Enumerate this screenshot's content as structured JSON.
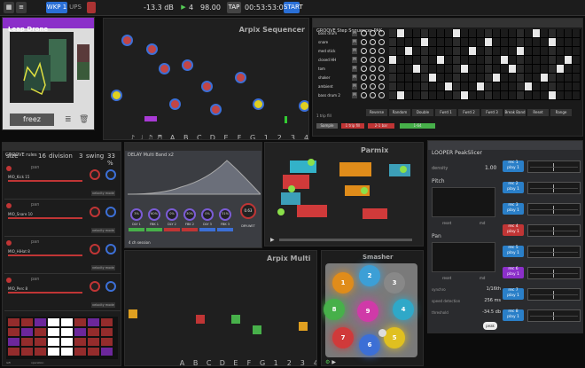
{
  "topbar": {
    "zoom_label": "WKP 1",
    "ups_label": "UPS",
    "db_value": "-13.3 dB",
    "bpm": "98.00",
    "tap": "TAP",
    "time": "00:53:53:08",
    "start": "START",
    "meter": "4"
  },
  "leap": {
    "title": "Leap Drone",
    "freeze": "freez"
  },
  "arpix_seq": {
    "title": "Arpix Sequencer",
    "letters": [
      "A",
      "B",
      "C",
      "D",
      "E",
      "F",
      "G"
    ],
    "numbers": [
      "1",
      "2",
      "3",
      "4",
      "5",
      "6",
      "7",
      "8",
      "S"
    ]
  },
  "groove": {
    "title": "GROOVE Step Sequencer PAK",
    "rows": [
      "bass drum",
      "snare",
      "med stick",
      "closed HH",
      "tom",
      "shaker",
      "ambient",
      "bass drum 2"
    ],
    "buttons": [
      "Reverse",
      "Random",
      "Double",
      "Fwrd 1",
      "Fwrd 2",
      "Fwrd 3",
      "Break Band",
      "Reset",
      "Range"
    ],
    "strip_label": "1 trip fill",
    "strip_vals": [
      "Sample",
      "1 trip fill",
      "2-1 bar",
      "1-64"
    ]
  },
  "groove_rules": {
    "title": "GROOVE rules",
    "size_label": "size",
    "size_val": "16",
    "div_label": "division",
    "div_val": "3",
    "swing_label": "swing",
    "swing_val": "33 %",
    "tracks": [
      "MIO_Kick 15",
      "MIO_Snare 10",
      "MIO_HiHat 8",
      "MIO_Perc 8"
    ],
    "velo": "velocity mode",
    "pan": "pan",
    "bottom_a": "left",
    "bottom_b": "operation"
  },
  "delay": {
    "title": "DELAY Multi Band x2",
    "knob_labels": [
      "DLY 1",
      "FBK 1",
      "DLY 2",
      "FBK 2",
      "DLY 3",
      "FBK 3"
    ],
    "knob_vals": [
      "3%",
      "60%",
      "0%",
      "30%",
      "0%",
      "31%"
    ],
    "drywet_label": "DRY-WET",
    "drywet_val": "0.63",
    "session": "4 ch session"
  },
  "parmix": {
    "title": "Parmix"
  },
  "looper": {
    "title": "LOOPER PeakSlicer",
    "density_label": "density",
    "density_val": "1.00",
    "pitch_label": "Pitch",
    "pan_label": "Pan",
    "reset": "reset",
    "md": "md",
    "rows": [
      {
        "label": "synchro",
        "val": "1/16th"
      },
      {
        "label": "speed detection",
        "val": "256 ms"
      },
      {
        "label": "threshold",
        "val": "-34.5 db"
      }
    ],
    "peak": "peak",
    "recs": [
      "rec 1",
      "rec 2",
      "rec 3",
      "rec 4",
      "rec 5",
      "rec 6",
      "rec 7",
      "rec 8"
    ],
    "play": "play 1"
  },
  "arpix_multi": {
    "title": "Arpix Multi",
    "letters": [
      "A",
      "B",
      "C",
      "D",
      "E",
      "F",
      "G"
    ],
    "numbers": [
      "1",
      "2",
      "3",
      "4",
      "5",
      "6",
      "7",
      "8",
      "S"
    ]
  },
  "smasher": {
    "title": "Smasher",
    "pads": [
      "1",
      "2",
      "3",
      "4",
      "5",
      "6",
      "7",
      "8",
      "9"
    ]
  }
}
